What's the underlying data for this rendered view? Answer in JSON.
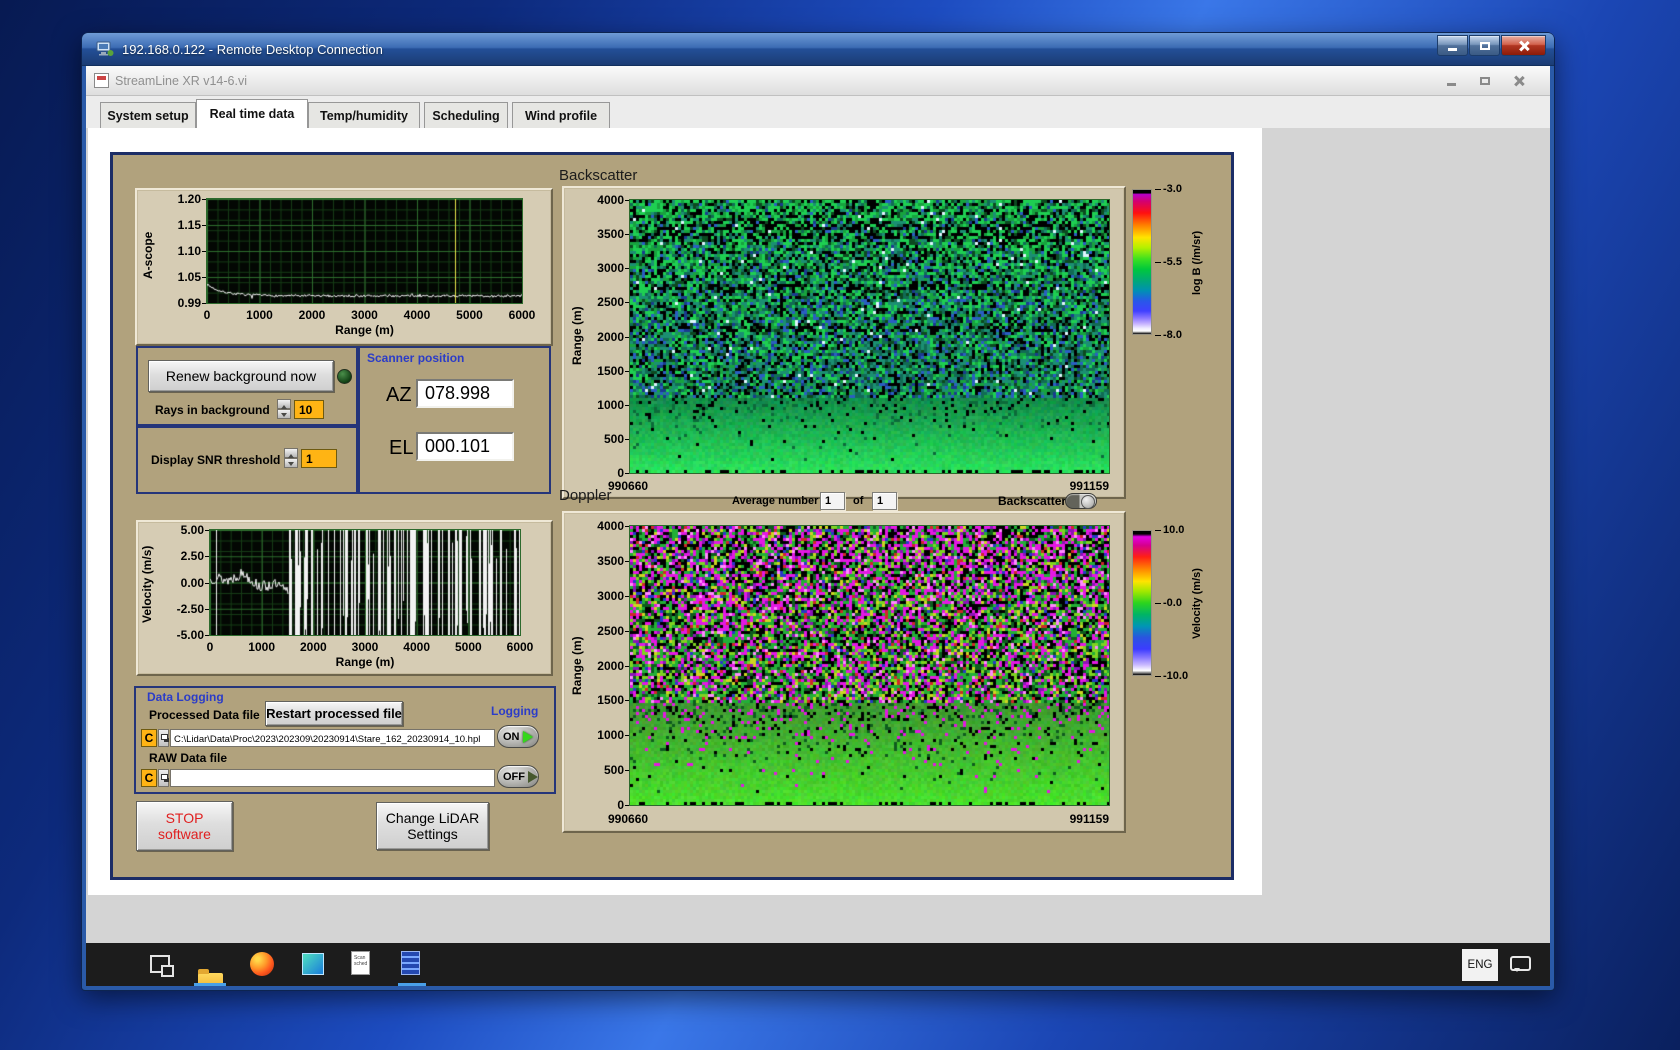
{
  "rdp": {
    "title": "192.168.0.122 - Remote Desktop Connection"
  },
  "app": {
    "title": "StreamLine XR v14-6.vi",
    "active_tab": "Real time data",
    "tabs": [
      {
        "label": "System setup"
      },
      {
        "label": "Real time data"
      },
      {
        "label": "Temp/humidity"
      },
      {
        "label": "Scheduling"
      },
      {
        "label": "Wind profile"
      }
    ]
  },
  "ascope": {
    "ylabel": "A-scope",
    "xlabel": "Range (m)",
    "yticks": [
      "1.20",
      "1.15",
      "1.10",
      "1.05",
      "0.99"
    ],
    "xticks": [
      "0",
      "1000",
      "2000",
      "3000",
      "4000",
      "5000",
      "6000"
    ]
  },
  "background_controls": {
    "renew_button": "Renew background now",
    "rays_label": "Rays in background",
    "rays_value": "10",
    "snr_label": "Display SNR threshold",
    "snr_value": "1"
  },
  "scanner": {
    "title": "Scanner position",
    "az_label": "AZ",
    "az_value": "078.998",
    "el_label": "EL",
    "el_value": "000.101"
  },
  "velocity": {
    "ylabel": "Velocity (m/s)",
    "xlabel": "Range (m)",
    "yticks": [
      "5.00",
      "2.50",
      "0.00",
      "-2.50",
      "-5.00"
    ],
    "xticks": [
      "0",
      "1000",
      "2000",
      "3000",
      "4000",
      "5000",
      "6000"
    ]
  },
  "backscatter": {
    "title": "Backscatter",
    "ylabel": "Range (m)",
    "yticks": [
      "4000",
      "3500",
      "3000",
      "2500",
      "2000",
      "1500",
      "1000",
      "500",
      "0"
    ],
    "x_start": "990660",
    "x_end": "991159",
    "colorbar_label": "log B (/m/sr)",
    "colorbar_ticks": [
      "-3.0",
      "-5.5",
      "-8.0"
    ],
    "colorbar_stops": [
      [
        0,
        "#000000"
      ],
      [
        2,
        "#000000"
      ],
      [
        3,
        "#b800c8"
      ],
      [
        8,
        "#d4006e"
      ],
      [
        16,
        "#ff1010"
      ],
      [
        24,
        "#ff7a00"
      ],
      [
        33,
        "#ffe400"
      ],
      [
        40,
        "#b4f000"
      ],
      [
        48,
        "#3ce020"
      ],
      [
        55,
        "#00c83c"
      ],
      [
        63,
        "#00a878"
      ],
      [
        70,
        "#0090b4"
      ],
      [
        77,
        "#2858e8"
      ],
      [
        84,
        "#4040ff"
      ],
      [
        89,
        "#8c78ff"
      ],
      [
        93,
        "#c8b4ff"
      ],
      [
        96,
        "#f0ecff"
      ],
      [
        98,
        "#ffffff"
      ],
      [
        100,
        "#000000"
      ]
    ]
  },
  "doppler": {
    "title": "Doppler",
    "avg_label": "Average number",
    "avg_value": "1",
    "of_label": "of",
    "avg_total": "1",
    "toggle_label": "Backscatter",
    "ylabel": "Range (m)",
    "yticks": [
      "4000",
      "3500",
      "3000",
      "2500",
      "2000",
      "1500",
      "1000",
      "500",
      "0"
    ],
    "x_start": "990660",
    "x_end": "991159",
    "colorbar_label": "Velocity (m/s)",
    "colorbar_ticks": [
      "10.0",
      "-0.0",
      "-10.0"
    ],
    "colorbar_stops": [
      [
        0,
        "#000000"
      ],
      [
        2,
        "#000000"
      ],
      [
        4,
        "#e400e4"
      ],
      [
        10,
        "#d4008c"
      ],
      [
        18,
        "#ff2014"
      ],
      [
        27,
        "#ff8c00"
      ],
      [
        35,
        "#ffe400"
      ],
      [
        42,
        "#a0e800"
      ],
      [
        50,
        "#2cd41e"
      ],
      [
        58,
        "#00b464"
      ],
      [
        66,
        "#0096b4"
      ],
      [
        74,
        "#2a54e0"
      ],
      [
        82,
        "#3c3cff"
      ],
      [
        88,
        "#8a7aff"
      ],
      [
        93,
        "#cabaff"
      ],
      [
        97,
        "#ffffff"
      ],
      [
        100,
        "#000000"
      ]
    ]
  },
  "data_logging": {
    "title": "Data Logging",
    "processed_label": "Processed Data file",
    "restart_button": "Restart processed file",
    "logging_label": "Logging",
    "drive_letter": "C",
    "processed_path": "C:\\Lidar\\Data\\Proc\\2023\\202309\\20230914\\Stare_162_20230914_10.hpl",
    "raw_label": "RAW Data file",
    "raw_path": "",
    "on_label": "ON",
    "off_label": "OFF"
  },
  "footer": {
    "stop_button": [
      "STOP",
      "software"
    ],
    "change_button": [
      "Change LiDAR",
      "Settings"
    ]
  },
  "taskbar": {
    "lang": "ENG",
    "scan_icon_text": [
      "Scan",
      "sched"
    ]
  },
  "chart_data": [
    {
      "id": "ascope",
      "type": "line",
      "title": "A-scope",
      "xlabel": "Range (m)",
      "ylabel": "A-scope",
      "xlim": [
        0,
        6000
      ],
      "ylim": [
        0.99,
        1.2
      ],
      "xticks": [
        0,
        1000,
        2000,
        3000,
        4000,
        5000,
        6000
      ],
      "yticks": [
        1.2,
        1.15,
        1.1,
        1.05,
        0.99
      ],
      "description": "flat noisy trace near 1.00 decaying from ~1.025 below 800 m; yellow cursor line near 4720 m",
      "cursor_x": 4720,
      "bg": "#030703",
      "grid_minor": "#163c16",
      "grid_major": "#2e6e2e",
      "line_color": "#f2f2f2",
      "cursor_color": "#e8e64a",
      "grid": true
    },
    {
      "id": "velocity",
      "type": "line",
      "title": "Velocity",
      "xlabel": "Range (m)",
      "ylabel": "Velocity (m/s)",
      "xlim": [
        0,
        6000
      ],
      "ylim": [
        -5,
        5
      ],
      "xticks": [
        0,
        1000,
        2000,
        3000,
        4000,
        5000,
        6000
      ],
      "yticks": [
        5.0,
        2.5,
        0.0,
        -2.5,
        -5.0
      ],
      "description": "coherent trace near 0 m/s out to ~1500 m, then dense full-scale vertical noise lines to 6000 m",
      "coherent_until_m": 1500,
      "noise_density": 0.6,
      "bg": "#030703",
      "grid_minor": "#163c16",
      "grid_major": "#2e6e2e",
      "line_color": "#f2f2f2",
      "grid": true
    },
    {
      "id": "backscatter",
      "type": "heatmap",
      "title": "Backscatter",
      "ylabel": "Range (m)",
      "x_start": 990660,
      "x_end": 991159,
      "ylim": [
        0,
        4000
      ],
      "colorbar": {
        "label": "log B (/m/sr)",
        "ticks": [
          -3.0,
          -5.5,
          -8.0
        ]
      },
      "description": "speckled green/teal/blue aerosol backscatter noise above ~1100 m, smooth bright green boundary layer below",
      "black_index": 6,
      "palette": [
        {
          "c": "#1ecf52",
          "w0": 0.3,
          "wf": -0.22
        },
        {
          "c": "#17a33e",
          "w0": 0.14
        },
        {
          "c": "#1b8f72",
          "w0": 0.08,
          "wf": 0.28
        },
        {
          "c": "#116b55",
          "w0": 0.05,
          "wf": 0.22
        },
        {
          "c": "#2a5ec2",
          "w0": 0.02,
          "wf": 0.14
        },
        {
          "c": "#1a3b8f",
          "w0": 0.01,
          "wf": 0.1
        },
        {
          "c": "#000000",
          "w0": 0.22
        },
        {
          "c": "#0c4a20",
          "w0": 0.1
        },
        {
          "c": "#dff5ff",
          "w0": 0.015
        }
      ],
      "streaks": [
        0.09,
        0.125,
        0.31,
        0.47
      ],
      "smooth": {
        "start": 0.72,
        "from": [
          18,
          140,
          74
        ],
        "to": [
          44,
          228,
          92
        ],
        "speckle": 0.18,
        "speckle_colors": [
          "#000000",
          "#0c6a3a"
        ]
      }
    },
    {
      "id": "doppler",
      "type": "heatmap",
      "title": "Doppler",
      "ylabel": "Range (m)",
      "x_start": 990660,
      "x_end": 991159,
      "ylim": [
        0,
        4000
      ],
      "colorbar": {
        "label": "Velocity (m/s)",
        "ticks": [
          10.0,
          -0.0,
          -10.0
        ]
      },
      "description": "magenta/green/black full-scale velocity noise above ~1400 m, smooth lime-green near-zero velocities below",
      "black_index": 4,
      "palette": [
        {
          "c": "#e318e3",
          "w0": 0.21,
          "wf": -0.06
        },
        {
          "c": "#8a14b8",
          "w0": 0.05
        },
        {
          "c": "#ff8aff",
          "w0": 0.05
        },
        {
          "c": "#d02828",
          "w0": 0.03
        },
        {
          "c": "#000000",
          "w0": 0.24
        },
        {
          "c": "#22b036",
          "w0": 0.11,
          "wf": 0.3
        },
        {
          "c": "#7ed321",
          "w0": 0.05,
          "wf": 0.18
        },
        {
          "c": "#cdd422",
          "w0": 0.05
        },
        {
          "c": "#0e5c1e",
          "w0": 0.08,
          "wf": 0.12
        },
        {
          "c": "#2838c8",
          "w0": 0.03
        }
      ],
      "streaks": [],
      "smooth": {
        "start": 0.63,
        "from": [
          62,
          152,
          48
        ],
        "to": [
          74,
          226,
          44
        ],
        "speckle": 0.35,
        "speckle_colors": [
          "#e318e3",
          "#000000",
          "#0e5c1e"
        ]
      }
    }
  ]
}
